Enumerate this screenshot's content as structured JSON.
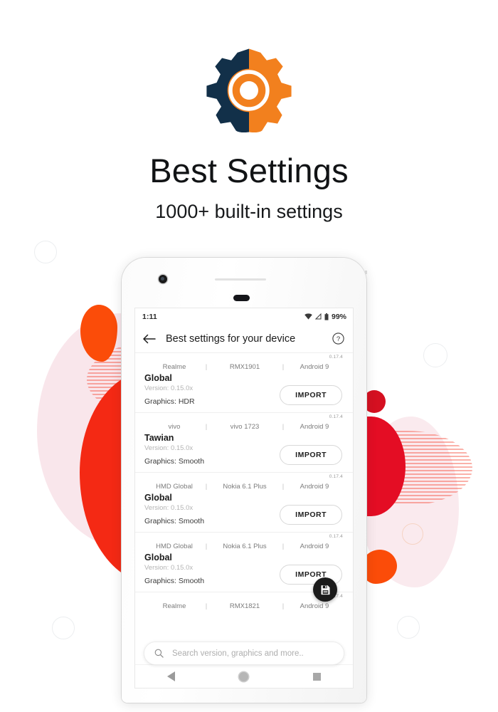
{
  "hero": {
    "logo_icon": "gear-icon",
    "logo_colors": {
      "dark": "#123049",
      "accent": "#f2801e",
      "inner": "#ffffff"
    },
    "title": "Best Settings",
    "subtitle": "1000+ built-in settings"
  },
  "phone": {
    "status_bar": {
      "time": "1:11",
      "wifi_icon": "wifi-icon",
      "signal_icon": "signal-icon",
      "battery_icon": "battery-icon",
      "battery_percent": "99%"
    },
    "app_bar": {
      "back_icon": "back-arrow-icon",
      "title": "Best settings for your device",
      "help_icon": "help-circle-icon"
    },
    "list_items": [
      {
        "badge": "0.17.4",
        "brand": "Realme",
        "model": "RMX1901",
        "os": "Android 9",
        "region": "Global",
        "version": "Version: 0.15.0x",
        "graphics": "Graphics: HDR",
        "import_label": "IMPORT"
      },
      {
        "badge": "0.17.4",
        "brand": "vivo",
        "model": "vivo 1723",
        "os": "Android 9",
        "region": "Tawian",
        "version": "Version: 0.15.0x",
        "graphics": "Graphics: Smooth",
        "import_label": "IMPORT"
      },
      {
        "badge": "0.17.4",
        "brand": "HMD Global",
        "model": "Nokia 6.1 Plus",
        "os": "Android 9",
        "region": "Global",
        "version": "Version: 0.15.0x",
        "graphics": "Graphics: Smooth",
        "import_label": "IMPORT"
      },
      {
        "badge": "0.17.4",
        "brand": "HMD Global",
        "model": "Nokia 6.1 Plus",
        "os": "Android 9",
        "region": "Global",
        "version": "Version: 0.15.0x",
        "graphics": "Graphics: Smooth",
        "import_label": "IMPORT"
      },
      {
        "badge": "0.17.4",
        "brand": "Realme",
        "model": "RMX1821",
        "os": "Android 9",
        "region": "",
        "version": "",
        "graphics": "",
        "import_label": ""
      }
    ],
    "separator": "|",
    "fab": {
      "icon": "save-floppy-icon"
    },
    "search": {
      "icon": "search-icon",
      "placeholder": "Search version, graphics and more.."
    },
    "nav_bar": {
      "back_icon": "nav-back-triangle-icon",
      "home_icon": "nav-home-circle-icon",
      "recents_icon": "nav-recents-square-icon"
    }
  },
  "background": {
    "red": "#f42914",
    "orange": "#fb4c09",
    "pink": "#f7dde3",
    "ring": "#eceef0"
  }
}
